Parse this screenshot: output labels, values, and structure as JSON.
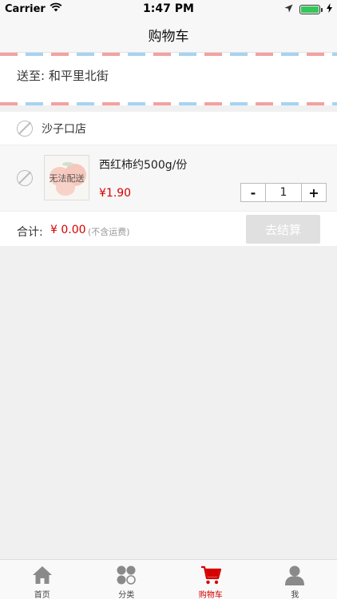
{
  "status_bar": {
    "carrier": "Carrier",
    "time": "1:47 PM"
  },
  "nav": {
    "title": "购物车"
  },
  "address": {
    "text": "送至: 和平里北街"
  },
  "store": {
    "name": "沙子口店"
  },
  "item": {
    "name": "西红柿约500g/份",
    "price": "¥1.90",
    "unavailable_label": "无法配送",
    "quantity": "1",
    "minus": "-",
    "plus": "+"
  },
  "summary": {
    "total_label": "合计:",
    "total_amount": "¥ 0.00",
    "shipping_note": "(不含运费)",
    "checkout_label": "去结算"
  },
  "tabs": [
    {
      "label": "首页",
      "icon": "home-icon",
      "active": false
    },
    {
      "label": "分类",
      "icon": "category-icon",
      "active": false
    },
    {
      "label": "购物车",
      "icon": "cart-icon",
      "active": true
    },
    {
      "label": "我",
      "icon": "user-icon",
      "active": false
    }
  ],
  "colors": {
    "accent": "#d50000",
    "disabled_button": "#e0e0e0",
    "battery": "#34c759"
  }
}
